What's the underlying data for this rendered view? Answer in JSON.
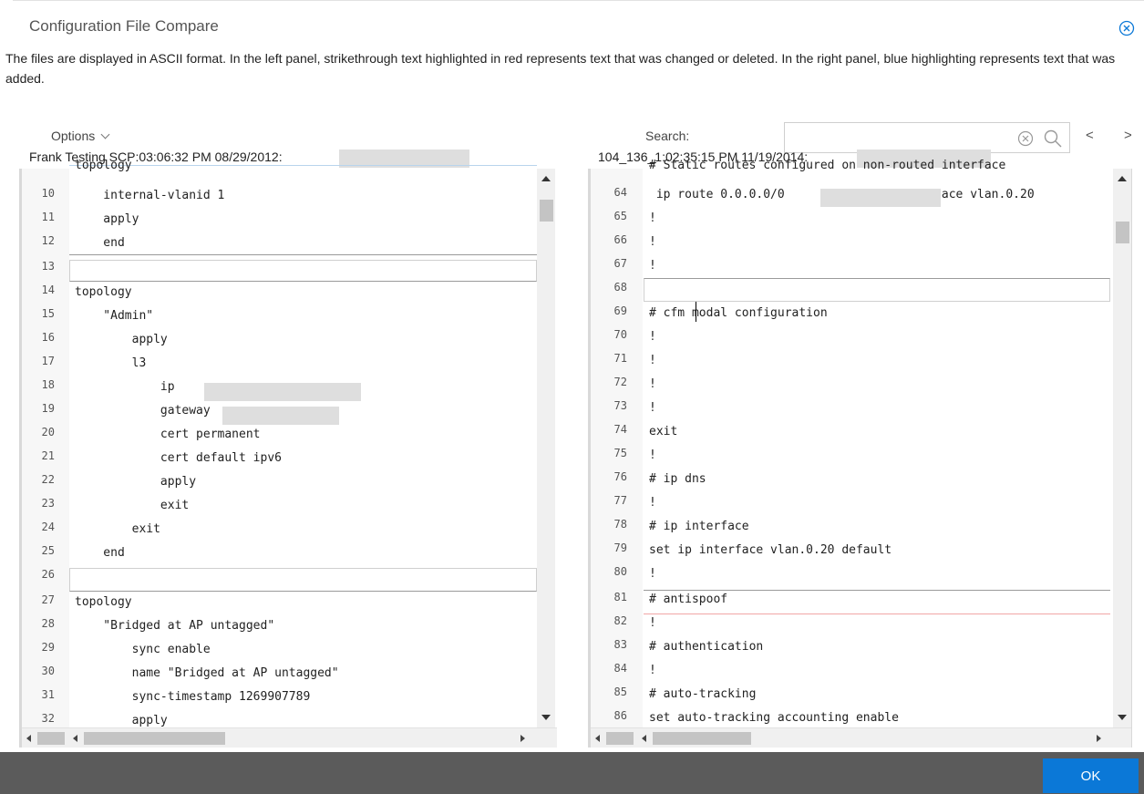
{
  "dialog": {
    "title": "Configuration File Compare",
    "description": "The files are displayed in ASCII format. In the left panel, strikethrough text highlighted in red represents text that was changed or deleted. In the right panel, blue highlighting represents text that was added.",
    "close_icon": "close-circle-icon"
  },
  "toolbar": {
    "options_label": "Options",
    "search_label": "Search:",
    "search_value": "",
    "prev_label": "<",
    "next_label": ">"
  },
  "left_file": {
    "label": "Frank Testing SCP:03:06:32 PM 08/29/2012:"
  },
  "right_file": {
    "label": "104_136_1:02:35:15 PM 11/19/2014:"
  },
  "left_lines": [
    {
      "num": "",
      "text": "topology"
    },
    {
      "num": "10",
      "text": "    internal-vlanid 1"
    },
    {
      "num": "11",
      "text": "    apply"
    },
    {
      "num": "12",
      "text": "    end"
    },
    {
      "num": "13",
      "text": ""
    },
    {
      "num": "14",
      "text": "topology"
    },
    {
      "num": "15",
      "text": "    \"Admin\""
    },
    {
      "num": "16",
      "text": "        apply"
    },
    {
      "num": "17",
      "text": "        l3"
    },
    {
      "num": "18",
      "text": "            ip"
    },
    {
      "num": "19",
      "text": "            gateway"
    },
    {
      "num": "20",
      "text": "            cert permanent"
    },
    {
      "num": "21",
      "text": "            cert default ipv6"
    },
    {
      "num": "22",
      "text": "            apply"
    },
    {
      "num": "23",
      "text": "            exit"
    },
    {
      "num": "24",
      "text": "        exit"
    },
    {
      "num": "25",
      "text": "    end"
    },
    {
      "num": "26",
      "text": ""
    },
    {
      "num": "27",
      "text": "topology"
    },
    {
      "num": "28",
      "text": "    \"Bridged at AP untagged\""
    },
    {
      "num": "29",
      "text": "        sync enable"
    },
    {
      "num": "30",
      "text": "        name \"Bridged at AP untagged\""
    },
    {
      "num": "31",
      "text": "        sync-timestamp 1269907789"
    },
    {
      "num": "32",
      "text": "        apply"
    }
  ],
  "right_lines": [
    {
      "num": "",
      "text": "# Static routes configured on non-routed interface"
    },
    {
      "num": "64",
      "text": " ip route 0.0.0.0/0                interface vlan.0.20"
    },
    {
      "num": "65",
      "text": "!"
    },
    {
      "num": "66",
      "text": "!"
    },
    {
      "num": "67",
      "text": "!"
    },
    {
      "num": "68",
      "text": ""
    },
    {
      "num": "69",
      "text": "# cfm modal configuration"
    },
    {
      "num": "70",
      "text": "!"
    },
    {
      "num": "71",
      "text": "!"
    },
    {
      "num": "72",
      "text": "!"
    },
    {
      "num": "73",
      "text": "!"
    },
    {
      "num": "74",
      "text": "exit"
    },
    {
      "num": "75",
      "text": "!"
    },
    {
      "num": "76",
      "text": "# ip dns"
    },
    {
      "num": "77",
      "text": "!"
    },
    {
      "num": "78",
      "text": "# ip interface"
    },
    {
      "num": "79",
      "text": "set ip interface vlan.0.20 default"
    },
    {
      "num": "80",
      "text": "!"
    },
    {
      "num": "81",
      "text": "# antispoof"
    },
    {
      "num": "82",
      "text": "!"
    },
    {
      "num": "83",
      "text": "# authentication"
    },
    {
      "num": "84",
      "text": "!"
    },
    {
      "num": "85",
      "text": "# auto-tracking"
    },
    {
      "num": "86",
      "text": "set auto-tracking accounting enable"
    }
  ],
  "footer": {
    "ok_label": "OK"
  },
  "colors": {
    "accent": "#0b78d7",
    "footer_bg": "#5b5b5b",
    "added_rule": "#f1a6a6"
  }
}
